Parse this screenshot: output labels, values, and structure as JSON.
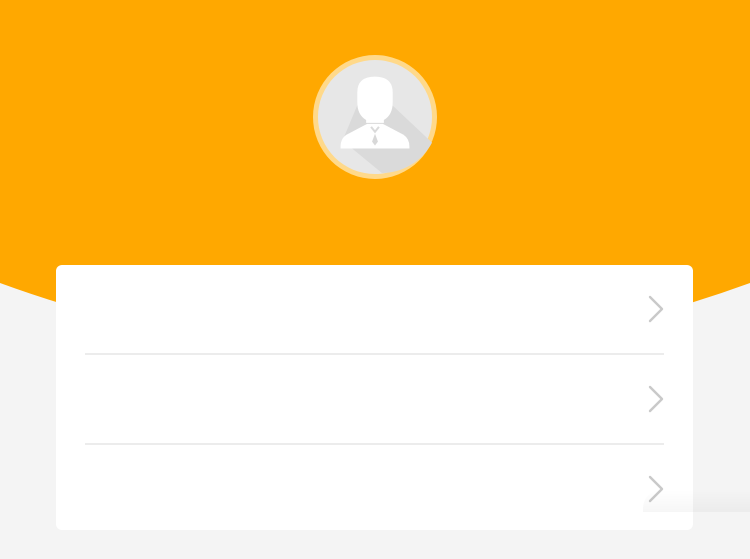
{
  "theme": {
    "accent": "#FFA800",
    "background": "#F4F4F4",
    "card": "#FFFFFF",
    "divider": "#ECECEC",
    "chevron": "#C9C9C9"
  },
  "header": {
    "avatar_icon": "user-avatar-placeholder-icon"
  },
  "menu": {
    "items": [
      {
        "label": "",
        "icon": "chevron-right-icon"
      },
      {
        "label": "",
        "icon": "chevron-right-icon"
      },
      {
        "label": "",
        "icon": "chevron-right-icon"
      }
    ]
  }
}
